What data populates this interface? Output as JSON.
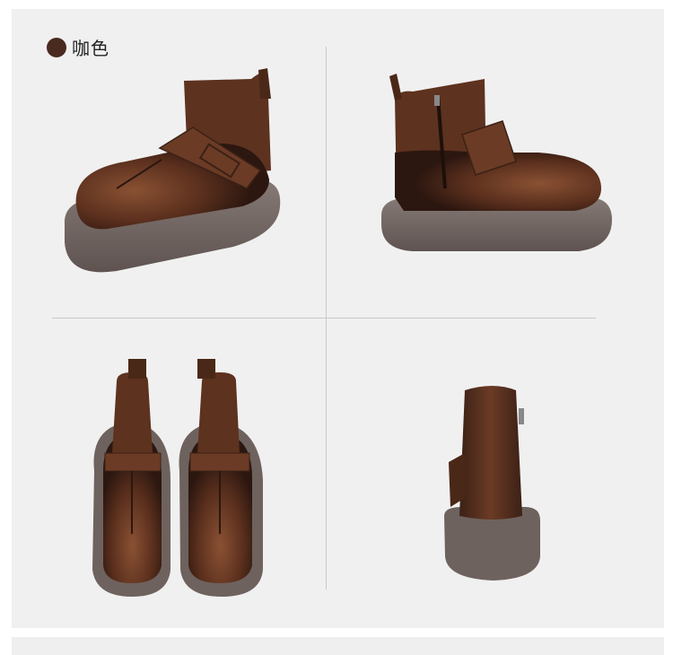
{
  "color_option": {
    "label": "咖色",
    "swatch_color": "#4a2a1e"
  },
  "views": [
    {
      "name": "side-view-left",
      "description_icon": "boot-side-left"
    },
    {
      "name": "side-view-right",
      "description_icon": "boot-side-right-zip"
    },
    {
      "name": "top-view-pair",
      "description_icon": "boots-top-pair"
    },
    {
      "name": "back-view",
      "description_icon": "boot-back"
    }
  ],
  "palette": {
    "leather_dark": "#3b2116",
    "leather_mid": "#6b3b25",
    "leather_light": "#8a5133",
    "sole": "#6e625e",
    "sole_top": "#857a76",
    "background": "#f0f0f0"
  }
}
